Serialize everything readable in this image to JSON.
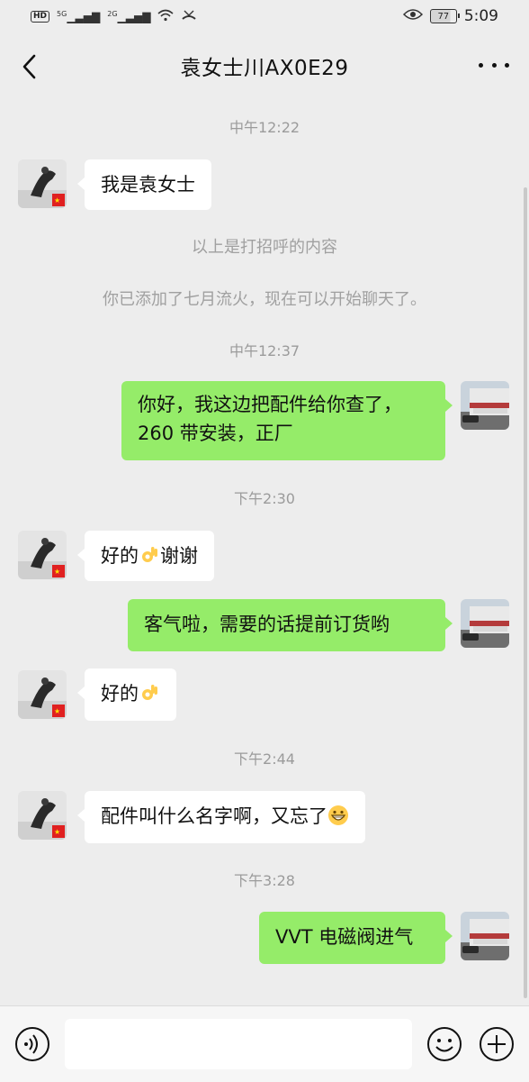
{
  "status_bar": {
    "hd": "HD",
    "net1": "5G",
    "net2": "2G",
    "battery": "77",
    "time": "5:09"
  },
  "header": {
    "title": "袁女士川AX0E29"
  },
  "messages": {
    "t1": "中午12:22",
    "m1": "我是袁女士",
    "sys1": "以上是打招呼的内容",
    "sys2": "你已添加了七月流火，现在可以开始聊天了。",
    "t2": "中午12:37",
    "m2_line1": "你好，我这边把配件给你查了，",
    "m2_line2": "260 带安装，正厂",
    "t3": "下午2:30",
    "m3_a": "好的",
    "m3_b": "谢谢",
    "m4": "客气啦，需要的话提前订货哟",
    "m5": "好的",
    "t4": "下午2:44",
    "m6": "配件叫什么名字啊，又忘了",
    "t5": "下午3:28",
    "m7": "VVT 电磁阀进气"
  },
  "input": {
    "placeholder": ""
  },
  "colors": {
    "background": "#ededed",
    "incoming_bubble": "#ffffff",
    "outgoing_bubble": "#95ec69",
    "timestamp_text": "#9b9b9b"
  },
  "icons": {
    "back": "chevron-left-icon",
    "more": "ellipsis-icon",
    "voice": "voice-icon",
    "emoji": "emoji-icon",
    "plus": "plus-icon",
    "ok_hand": "ok-hand-emoji",
    "grin": "grin-emoji"
  }
}
